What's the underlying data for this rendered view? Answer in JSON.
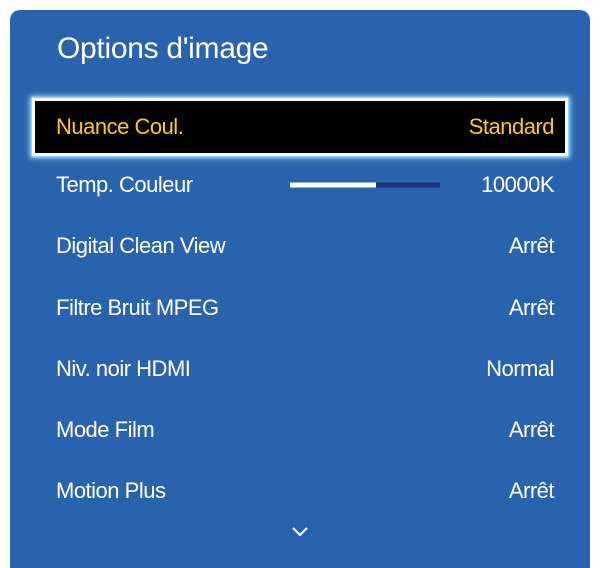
{
  "menu": {
    "title": "Options d'image",
    "items": [
      {
        "label": "Nuance Coul.",
        "value": "Standard",
        "selected": true
      },
      {
        "label": "Temp. Couleur",
        "value": "10000K",
        "slider_level": 0.57
      },
      {
        "label": "Digital Clean View",
        "value": "Arrêt"
      },
      {
        "label": "Filtre Bruit MPEG",
        "value": "Arrêt"
      },
      {
        "label": "Niv. noir HDMI",
        "value": "Normal"
      },
      {
        "label": "Mode Film",
        "value": "Arrêt"
      },
      {
        "label": "Motion Plus",
        "value": "Arrêt"
      }
    ],
    "scroll_indicator_icon": "chevron-down-icon"
  },
  "colors": {
    "panel_bg": "#2a63ad",
    "selected_bg": "#000000",
    "selected_text": "#ffc81e",
    "slider_fill": "#ffffff",
    "slider_track": "#1c2d7a"
  }
}
